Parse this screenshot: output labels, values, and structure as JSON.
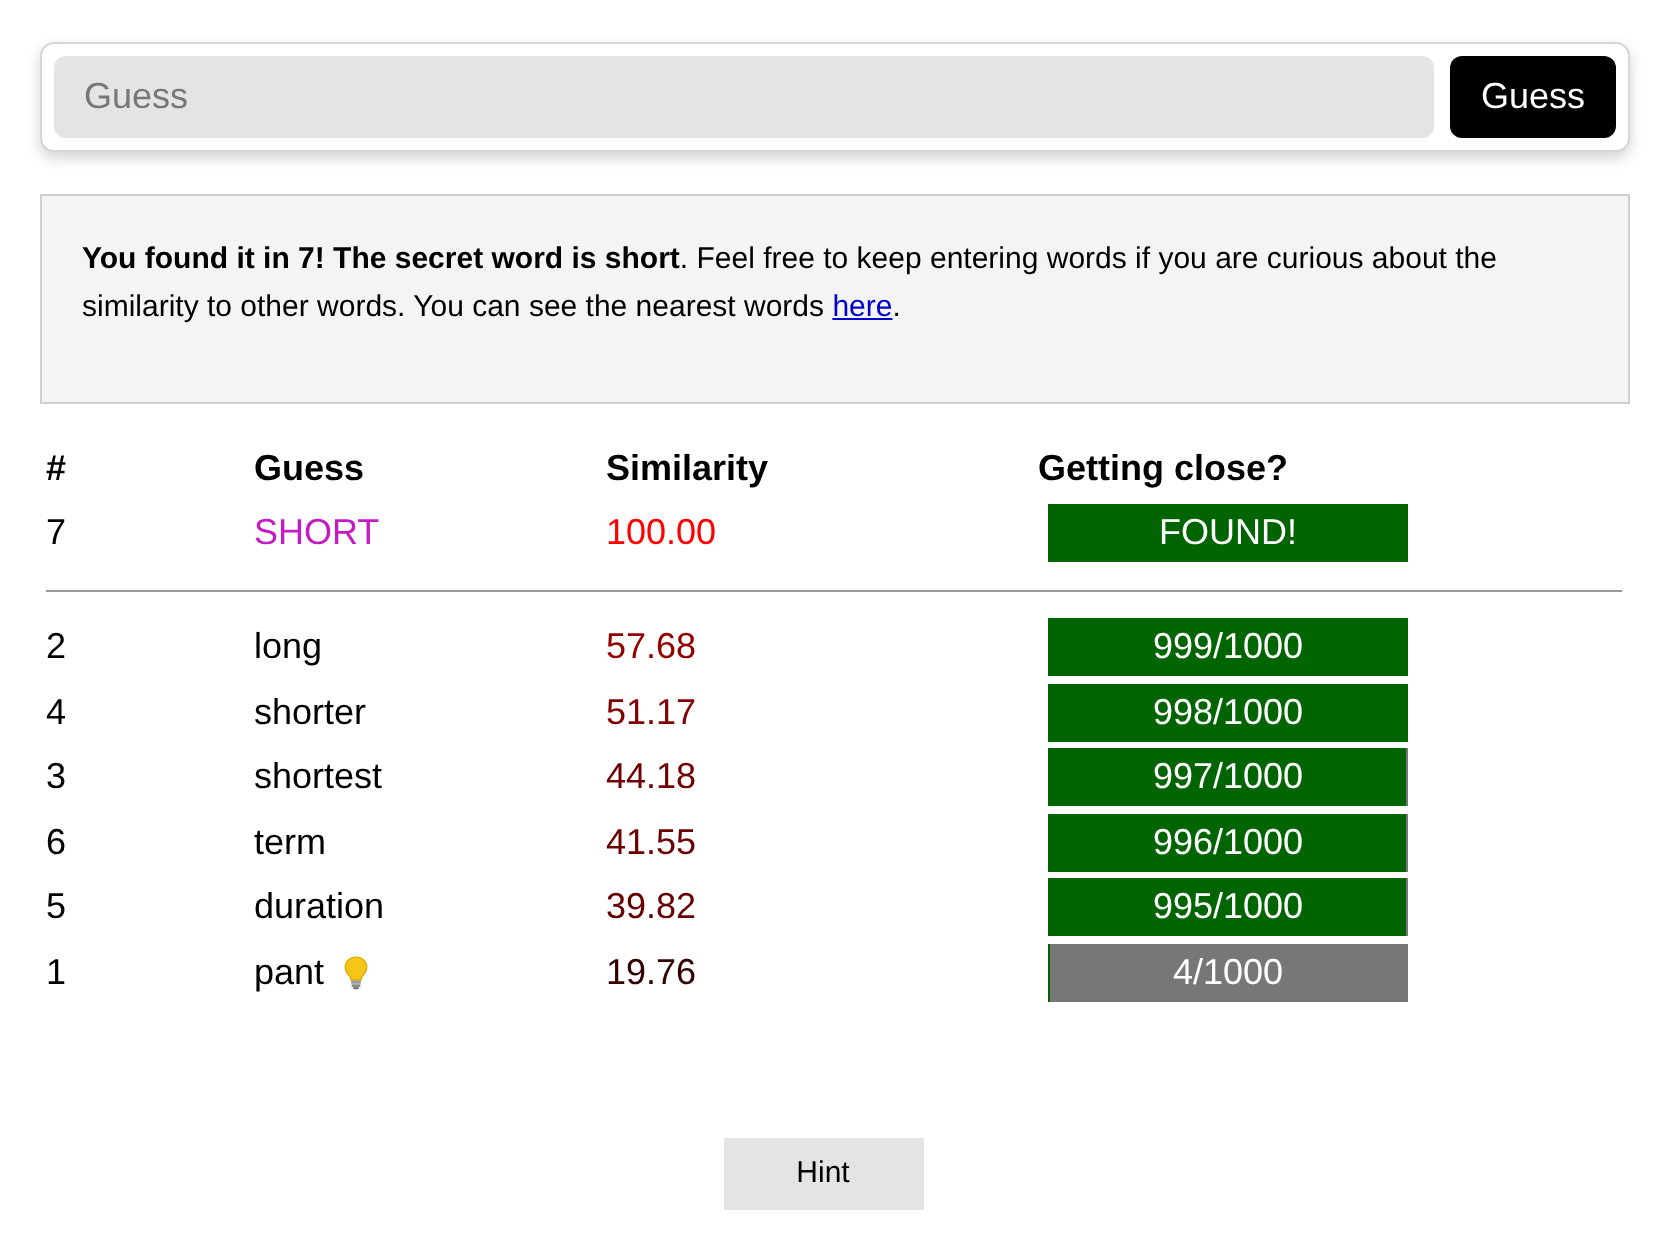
{
  "guess_form": {
    "placeholder": "Guess",
    "button": "Guess"
  },
  "message": {
    "text": "**You found it in 7! The secret word is short**. Feel free to keep entering words if you are curious about the similarity to other words. You can see the nearest words ",
    "link": "here",
    "text_end": "."
  },
  "table": {
    "columns": [
      "#",
      "Guess",
      "Similarity",
      "Getting close?"
    ],
    "latest_guess": {
      "number": "7",
      "word": "SHORT",
      "highlighted": true,
      "hint": false,
      "similarity": "100.00",
      "color": "#ff0000",
      "reading": "FOUND!",
      "level": 1
    },
    "rows": [
      {
        "number": "2",
        "word": "long",
        "highlighted": false,
        "hint": false,
        "similarity": "57.68",
        "color": "#930000",
        "reading": "999/1000",
        "level": 0.999
      },
      {
        "number": "4",
        "word": "shorter",
        "highlighted": false,
        "hint": false,
        "similarity": "51.17",
        "color": "#820000",
        "reading": "998/1000",
        "level": 0.998
      },
      {
        "number": "3",
        "word": "shortest",
        "highlighted": false,
        "hint": false,
        "similarity": "44.18",
        "color": "#710000",
        "reading": "997/1000",
        "level": 0.997
      },
      {
        "number": "6",
        "word": "term",
        "highlighted": false,
        "hint": false,
        "similarity": "41.55",
        "color": "#6a0000",
        "reading": "996/1000",
        "level": 0.996
      },
      {
        "number": "5",
        "word": "duration",
        "highlighted": false,
        "hint": false,
        "similarity": "39.82",
        "color": "#660000",
        "reading": "995/1000",
        "level": 0.995
      },
      {
        "number": "1",
        "word": "pant",
        "highlighted": false,
        "hint": true,
        "similarity": "19.76",
        "color": "#320000",
        "reading": "4/1000",
        "level": 0.004
      }
    ]
  },
  "hint_button": "Hint"
}
